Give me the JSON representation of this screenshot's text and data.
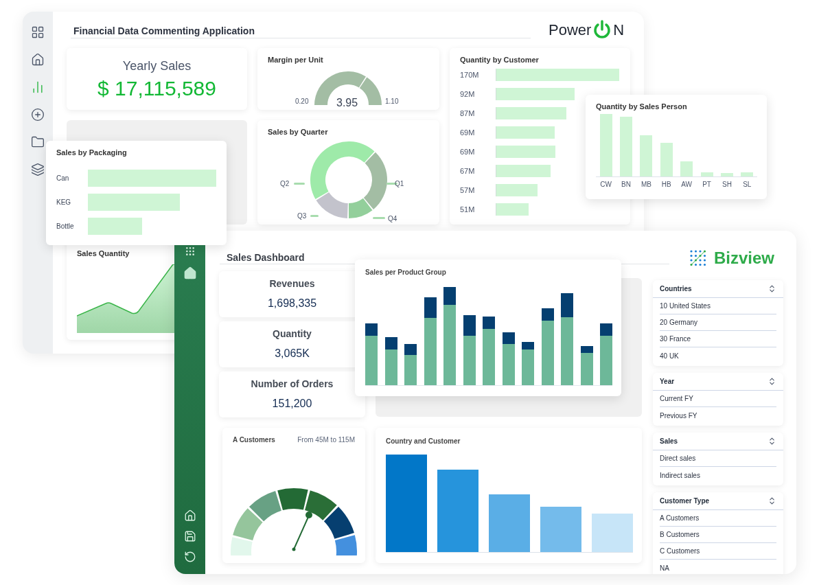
{
  "back_window": {
    "title": "Financial Data Commenting Application",
    "logo": {
      "before": "Power",
      "after": "N"
    },
    "sidebar": [
      {
        "kind": "grid",
        "selected": false
      },
      {
        "kind": "home",
        "selected": false
      },
      {
        "kind": "chart",
        "selected": true
      },
      {
        "kind": "add",
        "selected": false
      },
      {
        "kind": "folder",
        "selected": false
      },
      {
        "kind": "layers",
        "selected": false
      }
    ],
    "yearly_sales": {
      "title": "Yearly Sales",
      "value": "$ 17,115,589"
    },
    "margin_per_unit": {
      "title": "Margin per Unit",
      "min": "0.20",
      "value": "3.95",
      "max": "1.10"
    },
    "quantity_by_customer": {
      "title": "Quantity by Customer",
      "labels": [
        "170M",
        "92M",
        "87M",
        "69M",
        "69M",
        "67M",
        "57M",
        "51M"
      ]
    },
    "sales_by_quarter": {
      "title": "Sales by Quarter",
      "labels": [
        "Q1",
        "Q2",
        "Q3",
        "Q4"
      ]
    },
    "sales_quantity": {
      "title": "Sales Quantity"
    }
  },
  "sales_by_packaging": {
    "title": "Sales by Packaging",
    "categories": [
      "Can",
      "KEG",
      "Bottle"
    ]
  },
  "quantity_by_sales_person": {
    "title": "Quantity by Sales Person",
    "categories": [
      "CW",
      "BN",
      "MB",
      "HB",
      "AW",
      "PT",
      "SH",
      "SL"
    ]
  },
  "front_window": {
    "title": "Sales Dashboard",
    "logo": "Bizview",
    "sidebar_top": [
      {
        "kind": "apps"
      },
      {
        "kind": "home-filled"
      }
    ],
    "sidebar_bottom": [
      {
        "kind": "home"
      },
      {
        "kind": "save"
      },
      {
        "kind": "refresh"
      }
    ],
    "kpis": [
      {
        "label": "Revenues",
        "value": "1,698,335"
      },
      {
        "label": "Quantity",
        "value": "3,065K"
      },
      {
        "label": "Number of Orders",
        "value": "151,200"
      }
    ],
    "sales_per_product_group": {
      "title": "Sales per Product Group"
    },
    "a_customers": {
      "title": "A Customers",
      "range": "From 45M to 115M"
    },
    "country_and_customer": {
      "title": "Country and Customer"
    },
    "filters": [
      {
        "title": "Countries",
        "items": [
          "10 United States",
          "20 Germany",
          "30 France",
          "40 UK"
        ]
      },
      {
        "title": "Year",
        "items": [
          "Current FY",
          "Previous FY"
        ]
      },
      {
        "title": "Sales",
        "items": [
          "Direct sales",
          "Indirect sales"
        ]
      },
      {
        "title": "Customer Type",
        "items": [
          "A Customers",
          "B Customers",
          "C Customers",
          "NA"
        ]
      }
    ]
  }
}
